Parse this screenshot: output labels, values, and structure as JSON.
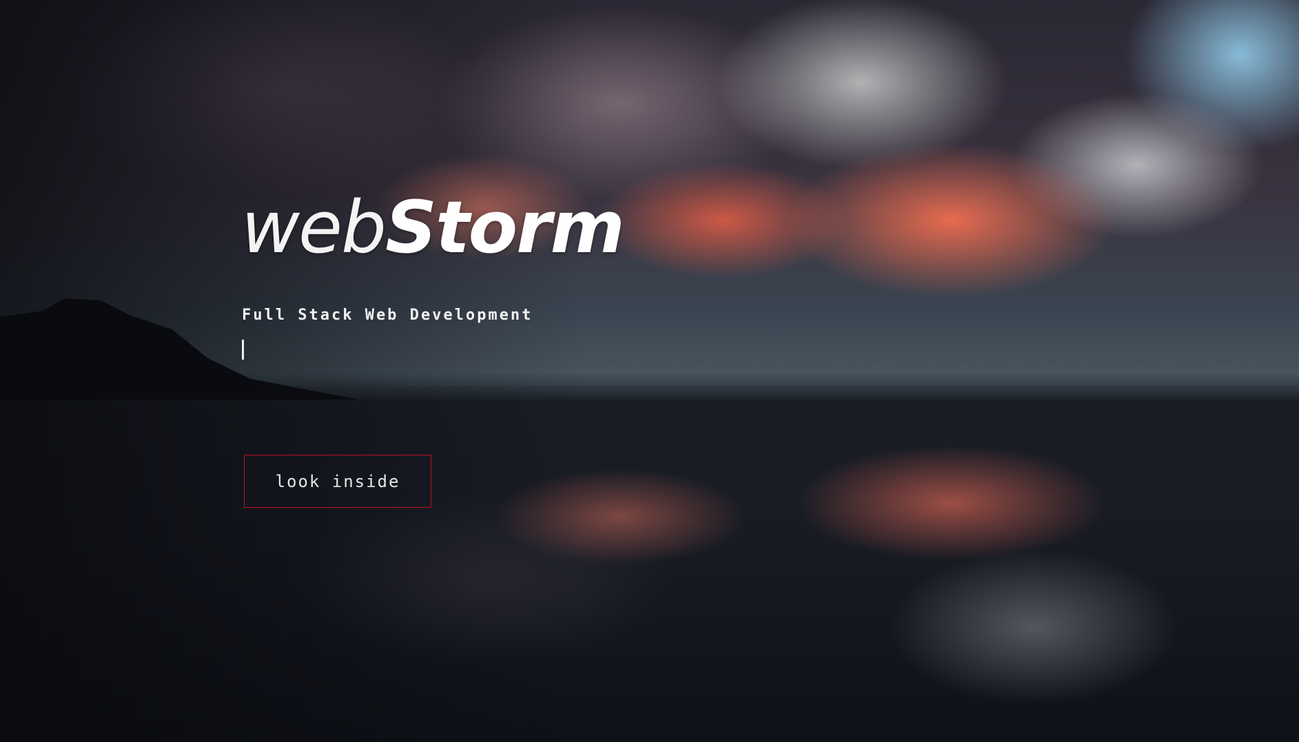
{
  "hero": {
    "brand_light": "web",
    "brand_bold": "Storm",
    "tagline": "Full Stack Web Development",
    "cta_label": "look inside",
    "accent_color": "#b3121e"
  }
}
